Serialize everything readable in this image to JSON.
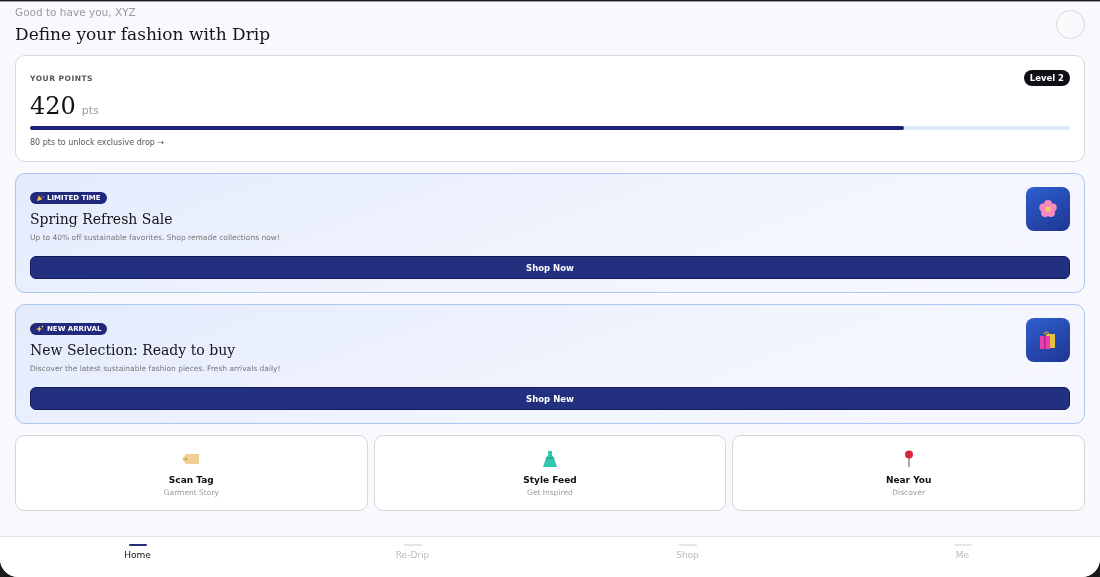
{
  "header": {
    "greeting": "Good to have you, XYZ",
    "title": "Define your fashion with Drip"
  },
  "points": {
    "label": "YOUR POINTS",
    "value": "420",
    "unit": "pts",
    "level_badge": "Level 2",
    "level": 0.84,
    "hint": "80 pts to unlock exclusive drop →"
  },
  "promos": [
    {
      "badge": "LIMITED TIME",
      "title": "Spring Refresh Sale",
      "text": "Up to 40% off sustainable favorites. Shop remade collections now!",
      "button": "Shop Now"
    },
    {
      "badge": "NEW ARRIVAL",
      "title": "New Selection: Ready to buy",
      "text": "Discover the latest sustainable fashion pieces. Fresh arrivals daily!",
      "button": "Shop New"
    }
  ],
  "quick_actions": [
    {
      "title": "Scan Tag",
      "subtitle": "Garment Story"
    },
    {
      "title": "Style Feed",
      "subtitle": "Get Inspired"
    },
    {
      "title": "Near You",
      "subtitle": "Discover"
    }
  ],
  "nav": [
    {
      "label": "Home",
      "selected": true
    },
    {
      "label": "Re-Drip",
      "selected": false
    },
    {
      "label": "Shop",
      "selected": false
    },
    {
      "label": "Me",
      "selected": false
    }
  ]
}
